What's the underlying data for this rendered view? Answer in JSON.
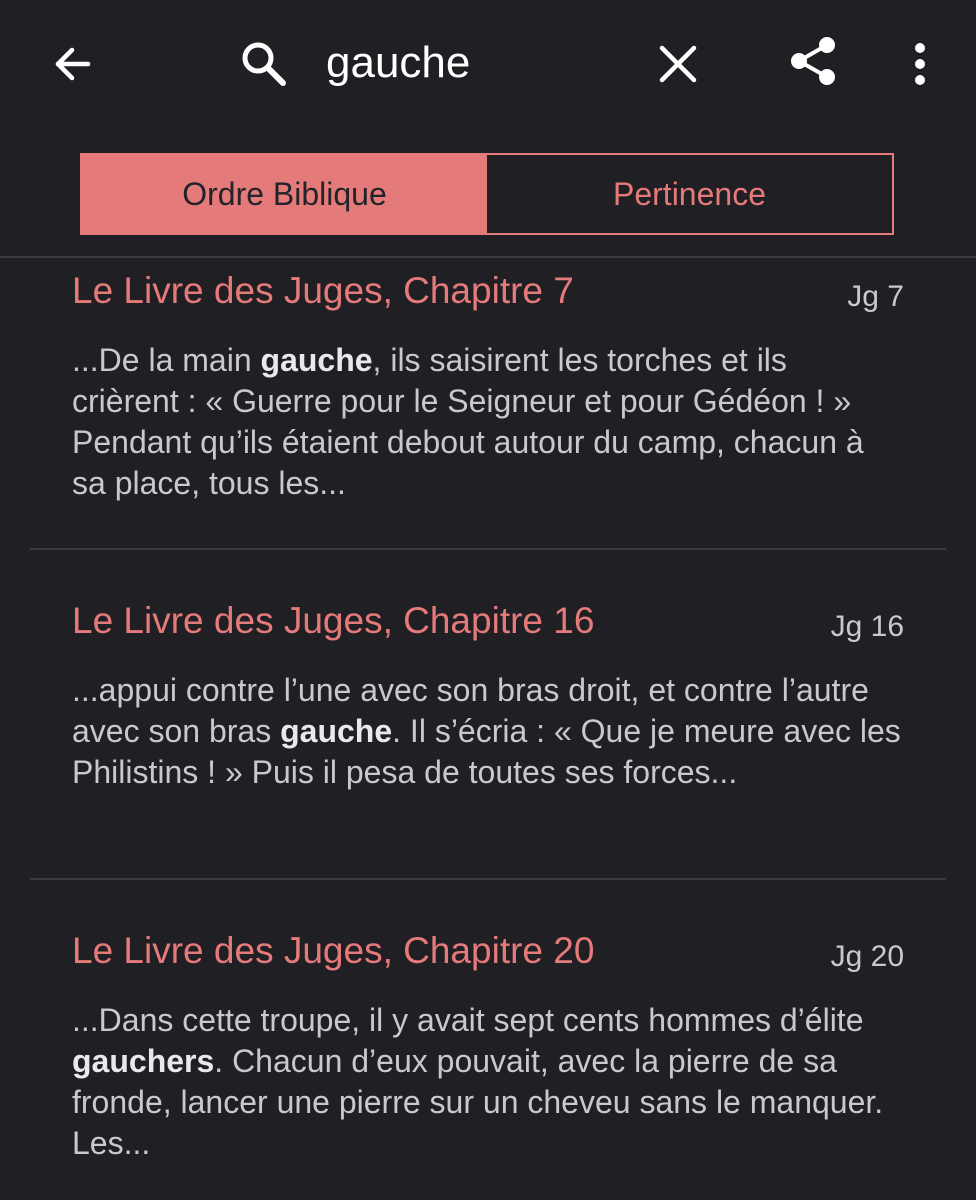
{
  "toolbar": {
    "back_icon": "arrow-left-icon",
    "search_icon": "search-icon",
    "search_value": "gauche",
    "clear_icon": "close-icon",
    "share_icon": "share-icon",
    "more_icon": "more-vertical-icon"
  },
  "sort_tabs": [
    {
      "label": "Ordre Biblique",
      "selected": true
    },
    {
      "label": "Pertinence",
      "selected": false
    }
  ],
  "colors": {
    "accent": "#e57a7a",
    "background": "#1f1f24",
    "text": "#c9c9cc",
    "divider": "#3a3a40"
  },
  "results": [
    {
      "title": "Le Livre des Juges, Chapitre 7",
      "ref": "Jg 7",
      "snippet_before": "...De la main ",
      "snippet_match": "gauche",
      "snippet_after": ", ils saisirent les torches et ils crièrent : « Guerre pour le Seigneur et pour Gédéon ! » Pendant qu’ils étaient debout autour du camp, chacun à sa place, tous les..."
    },
    {
      "title": "Le Livre des Juges, Chapitre 16",
      "ref": "Jg 16",
      "snippet_before": "...appui contre l’une avec son bras droit, et contre l’autre avec son bras ",
      "snippet_match": "gauche",
      "snippet_after": ". Il s’écria : « Que je meure avec les Philistins ! » Puis il pesa de toutes ses forces..."
    },
    {
      "title": "Le Livre des Juges, Chapitre 20",
      "ref": "Jg 20",
      "snippet_before": "...Dans cette troupe, il y avait sept cents hommes d’élite ",
      "snippet_match": "gauchers",
      "snippet_after": ". Chacun d’eux pouvait, avec la pierre de sa fronde, lancer une pierre sur un cheveu sans le manquer. Les..."
    }
  ]
}
